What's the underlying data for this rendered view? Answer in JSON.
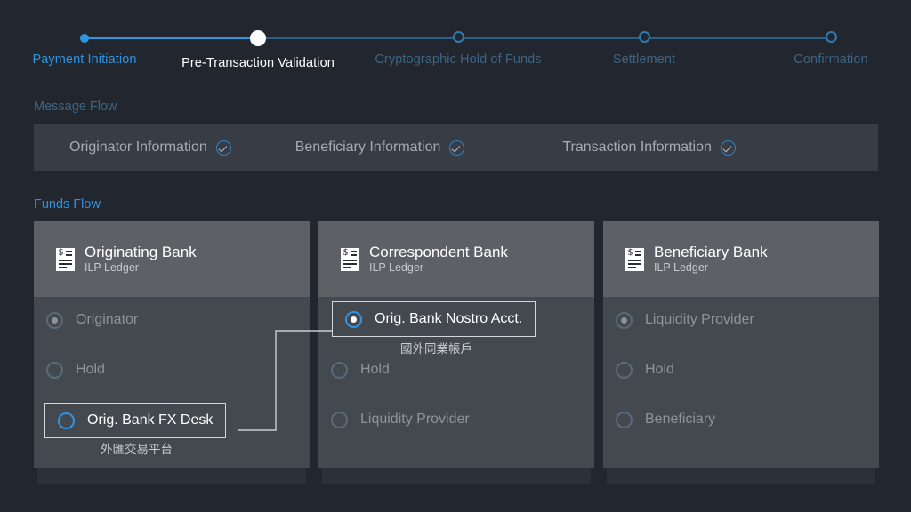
{
  "stepper": {
    "steps": [
      {
        "label": "Payment Initiation",
        "state": "done"
      },
      {
        "label": "Pre-Transaction Validation",
        "state": "current"
      },
      {
        "label": "Cryptographic Hold of Funds",
        "state": "todo"
      },
      {
        "label": "Settlement",
        "state": "todo"
      },
      {
        "label": "Confirmation",
        "state": "todo"
      }
    ]
  },
  "message_flow": {
    "label": "Message Flow",
    "items": [
      {
        "label": "Originator Information",
        "checked": true
      },
      {
        "label": "Beneficiary Information",
        "checked": true
      },
      {
        "label": "Transaction Information",
        "checked": true
      }
    ]
  },
  "funds_flow": {
    "label": "Funds Flow",
    "columns": [
      {
        "bank_name": "Originating Bank",
        "bank_sub": "ILP Ledger",
        "icon": "ledger-icon",
        "nodes": [
          {
            "label": "Originator",
            "radio": "filled-dim",
            "highlight": false,
            "cjk": ""
          },
          {
            "label": "Hold",
            "radio": "empty-dim",
            "highlight": false,
            "cjk": ""
          },
          {
            "label": "Orig. Bank FX Desk",
            "radio": "empty-active",
            "highlight": true,
            "cjk": "外匯交易平台"
          }
        ]
      },
      {
        "bank_name": "Correspondent Bank",
        "bank_sub": "ILP Ledger",
        "icon": "ledger-icon",
        "nodes": [
          {
            "label": "Orig. Bank Nostro Acct.",
            "radio": "filled-active",
            "highlight": true,
            "cjk": "國外同業帳戶"
          },
          {
            "label": "Hold",
            "radio": "empty-dim",
            "highlight": false,
            "cjk": ""
          },
          {
            "label": "Liquidity Provider",
            "radio": "empty-dim",
            "highlight": false,
            "cjk": ""
          }
        ]
      },
      {
        "bank_name": "Beneficiary Bank",
        "bank_sub": "ILP Ledger",
        "icon": "ledger-icon",
        "nodes": [
          {
            "label": "Liquidity Provider",
            "radio": "filled-dim",
            "highlight": false,
            "cjk": ""
          },
          {
            "label": "Hold",
            "radio": "empty-dim",
            "highlight": false,
            "cjk": ""
          },
          {
            "label": "Beneficiary",
            "radio": "empty-dim",
            "highlight": false,
            "cjk": ""
          }
        ]
      }
    ]
  },
  "colors": {
    "page_background": "#22262f",
    "accent_blue": "#2f95e0",
    "muted_blue": "#3d6582",
    "card_header": "#5d6166",
    "card_body": "#44484f",
    "bar_background": "#383d45",
    "highlight_border": "#d4d7da"
  }
}
